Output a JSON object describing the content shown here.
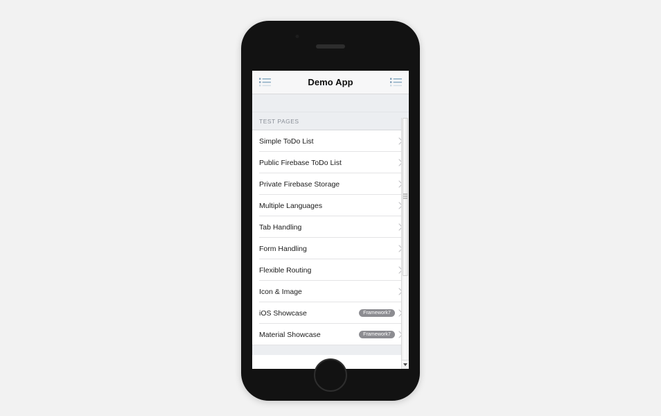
{
  "device": {
    "type": "smartphone-mockup",
    "speaker_icon": "speaker-grill",
    "camera_icon": "front-camera",
    "home_icon": "home-button"
  },
  "navbar": {
    "title": "Demo App",
    "left_icon": "list-bars-icon",
    "right_icon": "list-bars-icon",
    "icon_color": "#7b9bb5"
  },
  "content": {
    "list_title": "TEST PAGES",
    "chevron_icon": "chevron-right-icon",
    "badge_color": "#8c8c91",
    "items": [
      {
        "label": "Simple ToDo List",
        "badge": ""
      },
      {
        "label": "Public Firebase ToDo List",
        "badge": ""
      },
      {
        "label": "Private Firebase Storage",
        "badge": ""
      },
      {
        "label": "Multiple Languages",
        "badge": ""
      },
      {
        "label": "Tab Handling",
        "badge": ""
      },
      {
        "label": "Form Handling",
        "badge": ""
      },
      {
        "label": "Flexible Routing",
        "badge": ""
      },
      {
        "label": "Icon & Image",
        "badge": ""
      },
      {
        "label": "iOS Showcase",
        "badge": "Framework7"
      },
      {
        "label": "Material Showcase",
        "badge": "Framework7"
      }
    ]
  },
  "scrollbar": {
    "down_arrow_icon": "chevron-down-icon",
    "thumb_name": "scrollbar-thumb"
  },
  "background_color": "#f2f2f2"
}
